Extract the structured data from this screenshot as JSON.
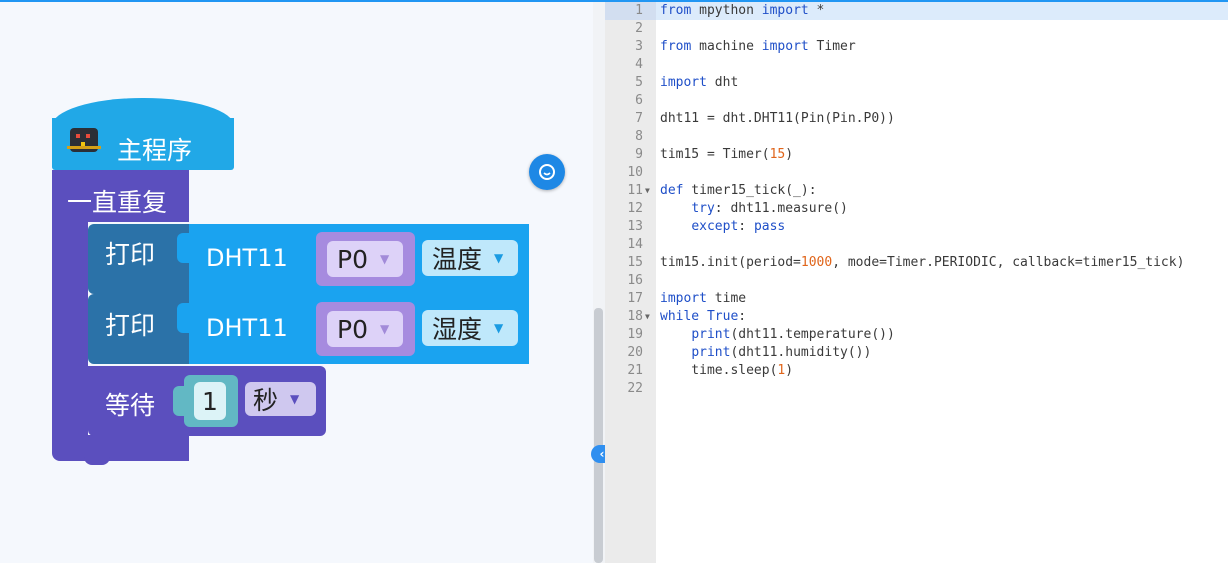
{
  "blocks": {
    "main_program": "主程序",
    "forever": "一直重复",
    "print_label": "打印",
    "sensor": "DHT11",
    "pin": "P0",
    "temperature": "温度",
    "humidity": "湿度",
    "wait_label": "等待",
    "wait_value": "1",
    "wait_unit": "秒"
  },
  "code_lines": [
    {
      "n": "1",
      "segs": [
        {
          "t": "from",
          "c": "kw"
        },
        {
          "t": " mpython "
        },
        {
          "t": "import",
          "c": "kw"
        },
        {
          "t": " *"
        }
      ]
    },
    {
      "n": "2",
      "segs": []
    },
    {
      "n": "3",
      "segs": [
        {
          "t": "from",
          "c": "kw"
        },
        {
          "t": " machine "
        },
        {
          "t": "import",
          "c": "kw"
        },
        {
          "t": " Timer"
        }
      ]
    },
    {
      "n": "4",
      "segs": []
    },
    {
      "n": "5",
      "segs": [
        {
          "t": "import",
          "c": "kw"
        },
        {
          "t": " dht"
        }
      ]
    },
    {
      "n": "6",
      "segs": []
    },
    {
      "n": "7",
      "segs": [
        {
          "t": "dht11 = dht.DHT11(Pin(Pin.P0))"
        }
      ]
    },
    {
      "n": "8",
      "segs": []
    },
    {
      "n": "9",
      "segs": [
        {
          "t": "tim15 = Timer("
        },
        {
          "t": "15",
          "c": "nm"
        },
        {
          "t": ")"
        }
      ]
    },
    {
      "n": "10",
      "segs": []
    },
    {
      "n": "11",
      "fold": true,
      "segs": [
        {
          "t": "def",
          "c": "kw"
        },
        {
          "t": " timer15_tick(_):"
        }
      ]
    },
    {
      "n": "12",
      "segs": [
        {
          "t": "    "
        },
        {
          "t": "try",
          "c": "kw"
        },
        {
          "t": ": dht11.measure()"
        }
      ]
    },
    {
      "n": "13",
      "segs": [
        {
          "t": "    "
        },
        {
          "t": "except",
          "c": "kw"
        },
        {
          "t": ": "
        },
        {
          "t": "pass",
          "c": "kw"
        }
      ]
    },
    {
      "n": "14",
      "segs": []
    },
    {
      "n": "15",
      "segs": [
        {
          "t": "tim15.init(period="
        },
        {
          "t": "1000",
          "c": "nm"
        },
        {
          "t": ", mode=Timer.PERIODIC, callback=timer15_tick)"
        }
      ]
    },
    {
      "n": "16",
      "segs": []
    },
    {
      "n": "17",
      "segs": [
        {
          "t": "import",
          "c": "kw"
        },
        {
          "t": " time"
        }
      ]
    },
    {
      "n": "18",
      "fold": true,
      "segs": [
        {
          "t": "while",
          "c": "kw"
        },
        {
          "t": " "
        },
        {
          "t": "True",
          "c": "kw"
        },
        {
          "t": ":"
        }
      ]
    },
    {
      "n": "19",
      "segs": [
        {
          "t": "    "
        },
        {
          "t": "print",
          "c": "kw"
        },
        {
          "t": "(dht11.temperature())"
        }
      ]
    },
    {
      "n": "20",
      "segs": [
        {
          "t": "    "
        },
        {
          "t": "print",
          "c": "kw"
        },
        {
          "t": "(dht11.humidity())"
        }
      ]
    },
    {
      "n": "21",
      "segs": [
        {
          "t": "    time.sleep("
        },
        {
          "t": "1",
          "c": "nm"
        },
        {
          "t": ")"
        }
      ]
    },
    {
      "n": "22",
      "segs": []
    }
  ]
}
